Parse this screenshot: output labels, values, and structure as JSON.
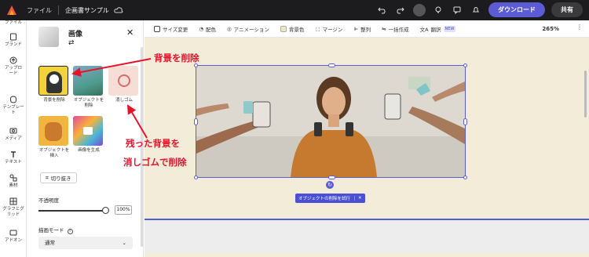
{
  "topbar": {
    "menu_file": "ファイル",
    "doc_title": "企画書サンプル",
    "download_label": "ダウンロード",
    "share_label": "共有"
  },
  "rail": {
    "items": [
      {
        "label": "ファイル",
        "icon": "file-icon"
      },
      {
        "label": "ブランド",
        "icon": "brand-icon"
      },
      {
        "label": "アップロード",
        "icon": "upload-icon"
      },
      {
        "label": "テンプレート",
        "icon": "template-icon"
      },
      {
        "label": "メディア",
        "icon": "media-icon"
      },
      {
        "label": "テキスト",
        "icon": "text-icon"
      },
      {
        "label": "素材",
        "icon": "elements-icon"
      },
      {
        "label": "グラフとグリッド",
        "icon": "grid-icon"
      },
      {
        "label": "アドオン",
        "icon": "addon-icon"
      }
    ]
  },
  "panel": {
    "title": "画像",
    "tools": [
      {
        "label": "背景を削除"
      },
      {
        "label": "オブジェクトを削除"
      },
      {
        "label": "消しゴム"
      },
      {
        "label": "オブジェクトを挿入"
      },
      {
        "label": "画像を生成"
      }
    ],
    "crop_label": "切り抜き",
    "opacity_label": "不透明度",
    "opacity_value": "100%",
    "opacity_level": 1.0,
    "blend_label": "描画モード",
    "blend_value": "通常"
  },
  "toolbar": {
    "items": [
      "サイズ変更",
      "配色",
      "アニメーション",
      "背景色",
      "マージン",
      "整列",
      "一括作成",
      "翻訳"
    ],
    "new_badge": "NEW",
    "zoom": "265%"
  },
  "canvas": {
    "try_pill": "オブジェクトの削除を試行",
    "page_bg": "#f2ecd9",
    "accent": "#5b5bd6"
  },
  "annotations": {
    "a1": "背景を削除",
    "a2_line1": "残った背景を",
    "a2_line2": "消しゴムで削除",
    "color": "#e8132b"
  }
}
